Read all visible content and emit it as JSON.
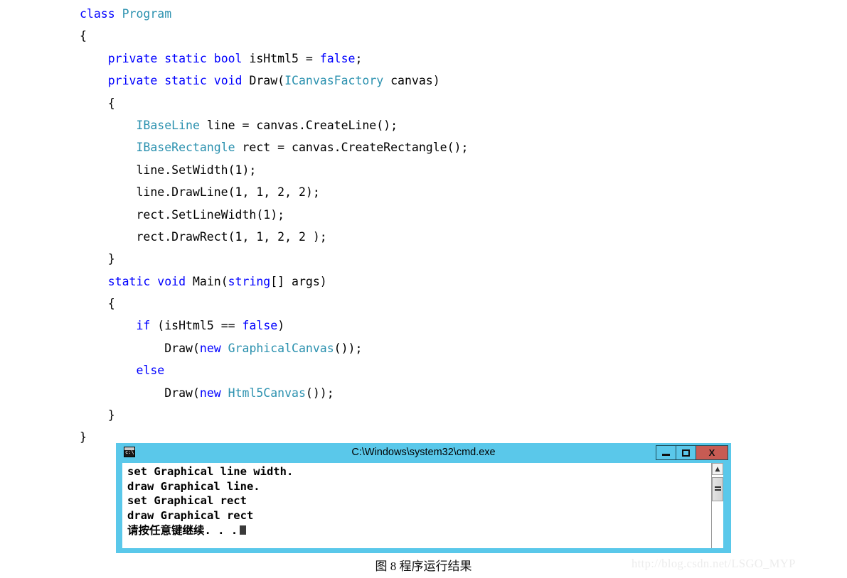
{
  "code": {
    "language": "csharp",
    "colors": {
      "keyword": "#0000ff",
      "type": "#2b91af",
      "plain": "#000000"
    },
    "lines": [
      [
        {
          "t": "class ",
          "c": "kw"
        },
        {
          "t": "Program",
          "c": "type"
        }
      ],
      [
        {
          "t": "{",
          "c": "pl"
        }
      ],
      [
        {
          "t": "    ",
          "c": "pl"
        },
        {
          "t": "private static bool ",
          "c": "kw"
        },
        {
          "t": "isHtml5 = ",
          "c": "pl"
        },
        {
          "t": "false",
          "c": "kw"
        },
        {
          "t": ";",
          "c": "pl"
        }
      ],
      [
        {
          "t": "    ",
          "c": "pl"
        },
        {
          "t": "private static void ",
          "c": "kw"
        },
        {
          "t": "Draw(",
          "c": "pl"
        },
        {
          "t": "ICanvasFactory",
          "c": "type"
        },
        {
          "t": " canvas)",
          "c": "pl"
        }
      ],
      [
        {
          "t": "    {",
          "c": "pl"
        }
      ],
      [
        {
          "t": "        ",
          "c": "pl"
        },
        {
          "t": "IBaseLine",
          "c": "type"
        },
        {
          "t": " line = canvas.CreateLine();",
          "c": "pl"
        }
      ],
      [
        {
          "t": "        ",
          "c": "pl"
        },
        {
          "t": "IBaseRectangle",
          "c": "type"
        },
        {
          "t": " rect = canvas.CreateRectangle();",
          "c": "pl"
        }
      ],
      [
        {
          "t": "        line.SetWidth(1);",
          "c": "pl"
        }
      ],
      [
        {
          "t": "        line.DrawLine(1, 1, 2, 2);",
          "c": "pl"
        }
      ],
      [
        {
          "t": "        rect.SetLineWidth(1);",
          "c": "pl"
        }
      ],
      [
        {
          "t": "        rect.DrawRect(1, 1, 2, 2 );",
          "c": "pl"
        }
      ],
      [
        {
          "t": "    }",
          "c": "pl"
        }
      ],
      [
        {
          "t": "    ",
          "c": "pl"
        },
        {
          "t": "static void ",
          "c": "kw"
        },
        {
          "t": "Main(",
          "c": "pl"
        },
        {
          "t": "string",
          "c": "kw"
        },
        {
          "t": "[] args)",
          "c": "pl"
        }
      ],
      [
        {
          "t": "    {",
          "c": "pl"
        }
      ],
      [
        {
          "t": "        ",
          "c": "pl"
        },
        {
          "t": "if ",
          "c": "kw"
        },
        {
          "t": "(isHtml5 == ",
          "c": "pl"
        },
        {
          "t": "false",
          "c": "kw"
        },
        {
          "t": ")",
          "c": "pl"
        }
      ],
      [
        {
          "t": "            Draw(",
          "c": "pl"
        },
        {
          "t": "new ",
          "c": "kw"
        },
        {
          "t": "GraphicalCanvas",
          "c": "type"
        },
        {
          "t": "());",
          "c": "pl"
        }
      ],
      [
        {
          "t": "        ",
          "c": "pl"
        },
        {
          "t": "else",
          "c": "kw"
        }
      ],
      [
        {
          "t": "            Draw(",
          "c": "pl"
        },
        {
          "t": "new ",
          "c": "kw"
        },
        {
          "t": "Html5Canvas",
          "c": "type"
        },
        {
          "t": "());",
          "c": "pl"
        }
      ],
      [
        {
          "t": "    }",
          "c": "pl"
        }
      ],
      [
        {
          "t": "}",
          "c": "pl"
        }
      ]
    ]
  },
  "console": {
    "title": "C:\\Windows\\system32\\cmd.exe",
    "icon": "cmd-icon",
    "titlebar_color": "#5ac8ea",
    "close_color": "#c75b53",
    "controls": {
      "minimize_label": "–",
      "maximize_label": "□",
      "close_label": "X"
    },
    "output_lines": [
      "set Graphical line width.",
      "draw Graphical line.",
      "set Graphical rect",
      "draw Graphical rect",
      "请按任意键继续. . ."
    ],
    "scrollbar": {
      "up_arrow": "▲"
    }
  },
  "caption": "图 8  程序运行结果",
  "watermark": "http://blog.csdn.net/LSGO_MYP"
}
